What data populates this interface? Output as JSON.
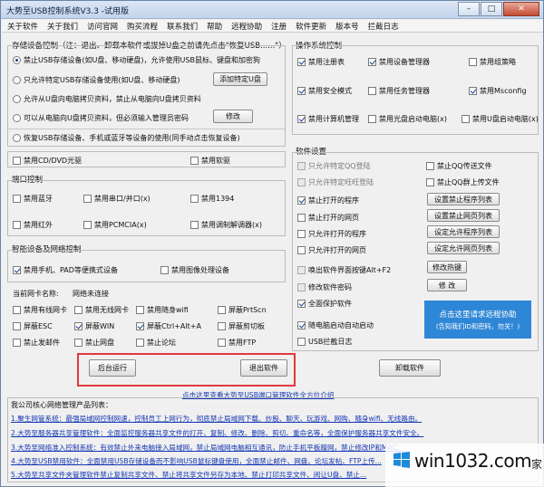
{
  "window": {
    "title": "大势至USB控制系统V3.3 -试用版",
    "min": "–",
    "max": "□",
    "close": "✕"
  },
  "menu": [
    "关于软件",
    "关于我们",
    "访问官网",
    "购买流程",
    "联系我们",
    "帮助",
    "远程协助",
    "注册",
    "软件更新",
    "版本号",
    "拦截日志"
  ],
  "storage": {
    "title": "存储设备控制（注：退出、卸载本软件或拔掉U盘之前请先点击\"恢复USB......\"）",
    "opt1": "禁止USB存储设备(如U盘、移动硬盘)，允许使用USB鼠标、键盘和加密狗",
    "opt2": "只允许特定USB存储设备使用(如U盘、移动硬盘)",
    "btn_add": "添加特定U盘",
    "opt3": "允许从U盘向电脑拷贝资料，禁止从电脑向U盘拷贝资料",
    "opt4": "可以从电脑向U盘拷贝资料，但必须输入管理员密码",
    "btn_modify": "修改",
    "opt5": "恢复USB存储设备、手机或蓝牙等设备的使用(同手动点击恢复设备)"
  },
  "cd": {
    "cdrom": "禁用CD/DVD光驱",
    "floppy": "禁用软驱"
  },
  "port": {
    "title": "端口控制",
    "bt": "禁用蓝牙",
    "serial": "禁用串口/并口(x)",
    "p1394": "禁用1394",
    "ir": "禁用红外",
    "pcmcia": "禁用PCMCIA(x)",
    "modem": "禁用调制解调器(x)"
  },
  "smart": {
    "title": "智能设备及网络控制",
    "phone": "禁用手机、PAD等便携式设备",
    "imaging": "禁用图像处理设备"
  },
  "net": {
    "nic_label": "当前网卡名称:",
    "nic_value": "网络未连接",
    "wired": "禁用有线网卡",
    "wireless": "禁用无线网卡",
    "wifi": "禁用随身wifi",
    "prtscn": "屏蔽PrtScn",
    "esc": "屏蔽ESC",
    "win": "屏蔽WIN",
    "ctrlaltA": "屏蔽Ctrl+Alt+A",
    "clipboard": "屏蔽剪切板",
    "mail": "禁止发邮件",
    "netdisk": "禁止网盘",
    "forum": "禁止论坛",
    "ftp": "禁用FTP"
  },
  "bottom": {
    "backend": "后台运行",
    "exit": "退出软件",
    "uninstall": "卸载软件"
  },
  "os": {
    "title": "操作系统控制",
    "regedit": "禁用注册表",
    "devmgr": "禁用设备管理器",
    "gpedit": "禁用组策略",
    "safemode": "禁用安全模式",
    "taskmgr": "禁用任务管理器",
    "msconfig": "禁用Msconfig",
    "compmgmt": "禁用计算机管理",
    "cdboot": "禁用光盘启动电脑(x)",
    "usbboot": "禁用U盘启动电脑(x)"
  },
  "sw": {
    "title": "软件设置",
    "qq_only": "只允许特定QQ登陆",
    "qq_file": "禁止QQ传送文件",
    "ww_only": "只允许特定旺旺登陆",
    "qq_group": "禁止QQ群上传文件",
    "block_prog": "禁止打开的程序",
    "btn_block_prog": "设置禁止程序列表",
    "block_web": "禁止打开的网页",
    "btn_block_web": "设置禁止网页列表",
    "allow_prog": "只允许打开的程序",
    "btn_allow_prog": "设定允许程序列表",
    "allow_web": "只允许打开的网页",
    "btn_allow_web": "设定允许网页列表",
    "hotkey": "唤出软件界面按键Alt+F2",
    "btn_hotkey": "修改热键",
    "pwd": "修改软件密码",
    "btn_pwd": "修 改",
    "protect": "全面保护软件",
    "autostart": "随电脑启动自动启动",
    "usblog": "USB拦截日志"
  },
  "remote": {
    "main": "点击这里请求远程协助",
    "sub": "(告知我们ID和密码，勿关！)"
  },
  "footer": {
    "link_all": "点击这里查看大势至USB端口管理软件全方位介绍",
    "products_title": "我公司核心网络管理产品列表：",
    "p1": "1.聚生网管系统：最强局域网控制网速，控制员工上网行为，彻底禁止局域网下载、炒股、聊天、玩游戏、网购、随身wifi、无线路由。",
    "p2": "2.大势至服务器共享管理软件：全面监控服务器共享文件的打开、复制、修改、删除、剪切、重命名等，全面保护服务器共享文件安全。",
    "p3": "3.大势至网络准入控制系统：有效禁止外来电脑接入局域网，禁止局域网电脑相互通讯，防止手机平板蹭网，禁止修改IP和MAC。",
    "p4": "4.大势至USB禁用软件：全面禁用USB存储设备而不影响USB鼠标键盘使用，全面禁止邮件、网盘、论坛发帖、FTP上传...",
    "p5": "5.大势至共享文件夹管理软件禁止复制共享文件、禁止将共享文件另存为本地、禁止打印共享文件、阅让U盘、禁止..."
  },
  "watermark": {
    "text": "win1032.com",
    "suffix": "家"
  }
}
